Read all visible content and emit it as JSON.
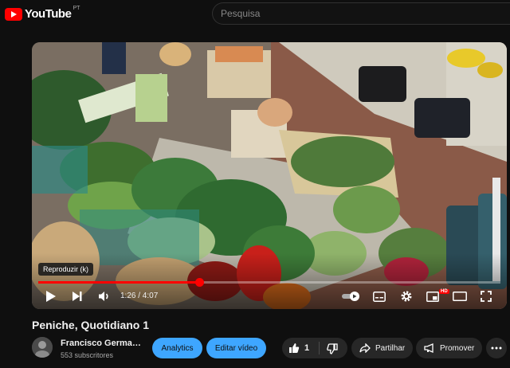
{
  "header": {
    "logo_text": "YouTube",
    "logo_region": "PT",
    "search_placeholder": "Pesquisa"
  },
  "player": {
    "tooltip": "Reproduzir (k)",
    "time_display": "1:26 / 4:07",
    "progress_fraction": 0.348,
    "hd_badge": "HD"
  },
  "video": {
    "title": "Peniche, Quotidiano 1"
  },
  "channel": {
    "name": "Francisco Germa…",
    "subscribers": "553 subscritores"
  },
  "actions": {
    "analytics_label": "Analytics",
    "edit_label": "Editar vídeo",
    "like_count": "1",
    "share_label": "Partilhar",
    "promote_label": "Promover"
  },
  "colors": {
    "accent_red": "#ff0000",
    "button_blue": "#3ea6ff",
    "pill_bg": "#272727",
    "page_bg": "#0f0f0f"
  }
}
